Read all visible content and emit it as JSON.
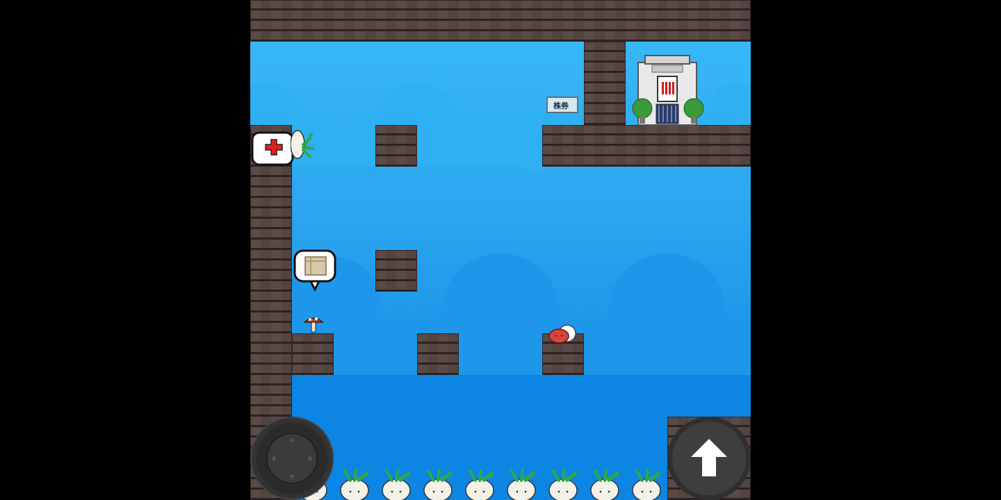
{
  "game": {
    "title": "",
    "sign": {
      "text": "株券"
    },
    "colors": {
      "sky_top": "#3bbcfa",
      "sky_bottom": "#0a82e3",
      "brick": "#4a3d3a",
      "mortar": "#2a2222"
    },
    "controls": {
      "joystick_icon": "dpad-icon",
      "jump_icon": "arrow-up-icon"
    },
    "items": [
      "heal-bubble",
      "box-bubble",
      "mushroom",
      "red-blob",
      "stock-building",
      "radish-row"
    ]
  }
}
